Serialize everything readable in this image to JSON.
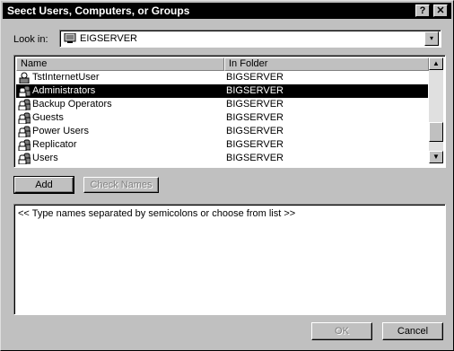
{
  "window": {
    "title": "Seect Users, Computers, or Groups",
    "help_label": "?",
    "close_label": "✕"
  },
  "lookin": {
    "label": "Look in:",
    "value": "EIGSERVER",
    "arrow": "▾"
  },
  "list": {
    "columns": [
      "Name",
      "In Folder"
    ],
    "rows": [
      {
        "name": "TstInternetUser",
        "folder": "BIGSERVER",
        "icon": "user-icon",
        "selected": false
      },
      {
        "name": "Administrators",
        "folder": "BIGSERVER",
        "icon": "group-icon",
        "selected": true
      },
      {
        "name": "Backup Operators",
        "folder": "BIGSERVER",
        "icon": "group-icon",
        "selected": false
      },
      {
        "name": "Guests",
        "folder": "BIGSERVER",
        "icon": "group-icon",
        "selected": false
      },
      {
        "name": "Power Users",
        "folder": "BIGSERVER",
        "icon": "group-icon",
        "selected": false
      },
      {
        "name": "Replicator",
        "folder": "BIGSERVER",
        "icon": "group-icon",
        "selected": false
      },
      {
        "name": "Users",
        "folder": "BIGSERVER",
        "icon": "group-icon",
        "selected": false
      }
    ],
    "scroll_up": "▲",
    "scroll_down": "▼"
  },
  "actions": {
    "add_label": "Add",
    "check_names_label": "Check Names"
  },
  "names_box": {
    "placeholder": "<< Type names separated by semicolons or choose from list >>"
  },
  "footer": {
    "ok_label": "OK",
    "cancel_label": "Cancel"
  }
}
